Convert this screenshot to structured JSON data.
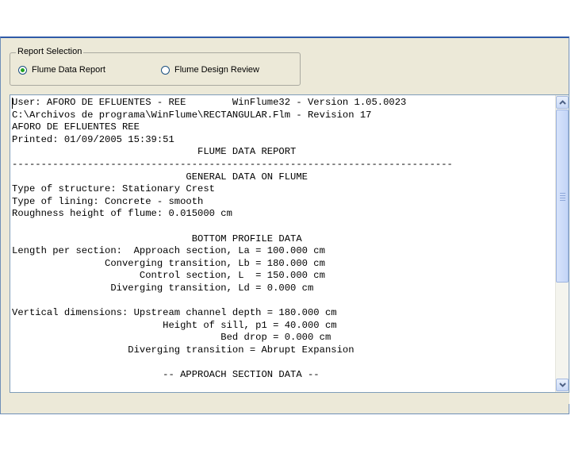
{
  "report_selection": {
    "legend": "Report Selection",
    "options": [
      {
        "label": "Flume Data Report",
        "selected": true
      },
      {
        "label": "Flume Design Review",
        "selected": false
      }
    ]
  },
  "report_lines": [
    "User: AFORO DE EFLUENTES - REE        WinFlume32 - Version 1.05.0023",
    "C:\\Archivos de programa\\WinFlume\\RECTANGULAR.Flm - Revision 17",
    "AFORO DE EFLUENTES REE",
    "Printed: 01/09/2005 15:39:51",
    "                                FLUME DATA REPORT",
    "----------------------------------------------------------------------------",
    "                              GENERAL DATA ON FLUME",
    "Type of structure: Stationary Crest",
    "Type of lining: Concrete - smooth",
    "Roughness height of flume: 0.015000 cm",
    "",
    "                               BOTTOM PROFILE DATA",
    "Length per section:  Approach section, La = 100.000 cm",
    "                Converging transition, Lb = 180.000 cm",
    "                      Control section, L  = 150.000 cm",
    "                 Diverging transition, Ld = 0.000 cm",
    "",
    "Vertical dimensions: Upstream channel depth = 180.000 cm",
    "                          Height of sill, p1 = 40.000 cm",
    "                                    Bed drop = 0.000 cm",
    "                    Diverging transition = Abrupt Expansion",
    "",
    "                          -- APPROACH SECTION DATA --"
  ],
  "icons": {
    "scroll_up": "triangle-up-icon",
    "scroll_down": "triangle-down-icon"
  },
  "colors": {
    "window_bg": "#ece9d8",
    "radio_dot": "#21a121",
    "scroll_accent": "#4d6185"
  }
}
